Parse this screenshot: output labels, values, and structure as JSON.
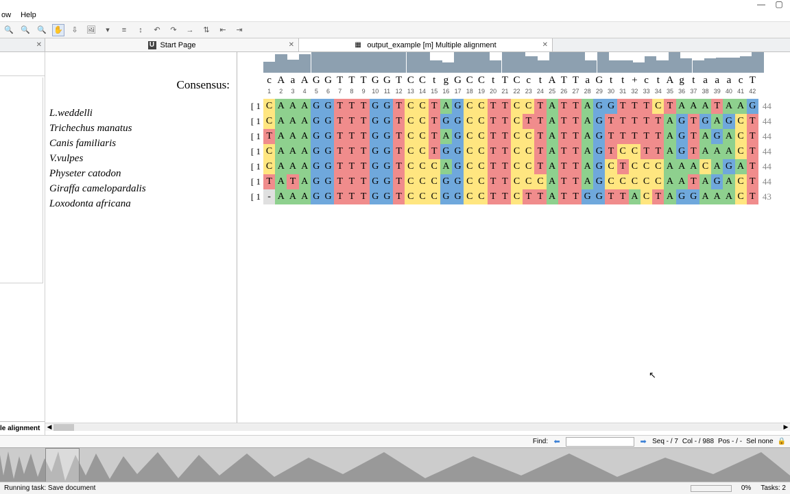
{
  "menu": {
    "window": "ow",
    "help": "Help"
  },
  "tabs": {
    "start": "Start Page",
    "align": "output_example [m] Multiple alignment"
  },
  "side_label": "le alignment",
  "consensus_label": "Consensus:",
  "ruler_start": 1,
  "ruler_end": 42,
  "consensus_seq": "cAaAGGTTTGGTCCtgGCCtTCctATTaGtt+ctAgtaaacT",
  "histogram": [
    55,
    90,
    65,
    90,
    100,
    100,
    100,
    100,
    100,
    100,
    100,
    100,
    100,
    100,
    60,
    50,
    100,
    100,
    100,
    60,
    100,
    100,
    80,
    60,
    100,
    100,
    100,
    60,
    100,
    60,
    60,
    50,
    80,
    60,
    100,
    70,
    60,
    70,
    72,
    72,
    80,
    100
  ],
  "sequences": [
    {
      "name": "L.weddelli",
      "start": 1,
      "seq": "CAAAGGTTTGGTCCTAGCCTTCCTATTAGGTTTCTAAATAAGAT",
      "end": 44
    },
    {
      "name": "Trichechus manatus",
      "start": 1,
      "seq": "CAAAGGTTTGGTCCTGGCCTTCTTATTAGTTTTTAGTGAGCT",
      "end": 44
    },
    {
      "name": "Canis familiaris",
      "start": 1,
      "seq": "TAAAGGTTTGGTCCTAGCCTTCCTATTAGTTTTTAGTAGACT",
      "end": 44
    },
    {
      "name": "V.vulpes",
      "start": 1,
      "seq": "CAAAGGTTTGGTCCTGGCCTTCCTATTAGTCCTTAGTAAACT",
      "end": 44
    },
    {
      "name": "Physeter catodon",
      "start": 1,
      "seq": "CAAAGGTTTGGTCCCAGCCTTCCTATTAGCTCCCAAACAGATT",
      "end": 44
    },
    {
      "name": "Giraffa camelopardalis",
      "start": 1,
      "seq": "TATAGGTTTGGTCCCGGCCTTCCCATTAGCCCCCAATAGACT",
      "end": 44
    },
    {
      "name": "Loxodonta africana",
      "start": 1,
      "seq": "-AAAGGTTTGGTCCCGGCCTTCTTATTGGTTACTAGGAAACT",
      "end": 43
    }
  ],
  "findbar": {
    "label": "Find:",
    "seq": "Seq - / 7",
    "col": "Col - / 988",
    "pos": "Pos - / -",
    "sel": "Sel none"
  },
  "status": {
    "task": "Running task: Save document",
    "pct": "0%",
    "tasks": "Tasks: 2"
  },
  "chart_data": {
    "type": "bar",
    "title": "Consensus conservation",
    "categories_range": [
      1,
      42
    ],
    "values": [
      55,
      90,
      65,
      90,
      100,
      100,
      100,
      100,
      100,
      100,
      100,
      100,
      100,
      100,
      60,
      50,
      100,
      100,
      100,
      60,
      100,
      100,
      80,
      60,
      100,
      100,
      100,
      60,
      100,
      60,
      60,
      50,
      80,
      60,
      100,
      70,
      60,
      70,
      72,
      72,
      80,
      100
    ],
    "ylim": [
      0,
      100
    ]
  }
}
